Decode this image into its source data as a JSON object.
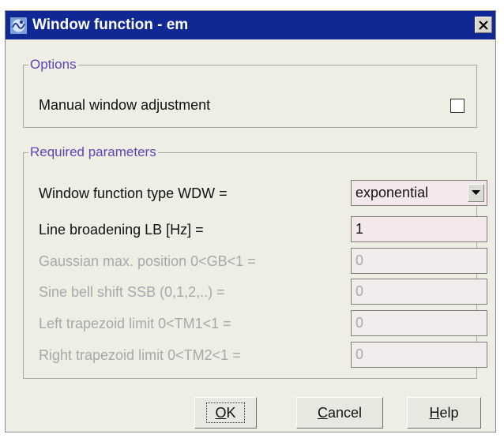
{
  "window": {
    "title": "Window function - em",
    "app_icon": "topspin-logo-icon",
    "close_icon": "close-icon"
  },
  "options": {
    "legend": "Options",
    "manual_adjustment": {
      "label": "Manual window adjustment",
      "checked": false
    }
  },
  "parameters": {
    "legend": "Required parameters",
    "rows": [
      {
        "label": "Window function type WDW =",
        "value": "exponential",
        "control": "select",
        "enabled": true
      },
      {
        "label": "Line broadening LB [Hz] =",
        "value": "1",
        "control": "text",
        "enabled": true
      },
      {
        "label": "Gaussian max. position 0<GB<1 =",
        "value": "0",
        "control": "text",
        "enabled": false
      },
      {
        "label": "Sine bell shift SSB (0,1,2,..) =",
        "value": "0",
        "control": "text",
        "enabled": false
      },
      {
        "label": "Left trapezoid limit 0<TM1<1 =",
        "value": "0",
        "control": "text",
        "enabled": false
      },
      {
        "label": "Right trapezoid limit 0<TM2<1 =",
        "value": "0",
        "control": "text",
        "enabled": false
      }
    ]
  },
  "buttons": {
    "ok": {
      "label": "OK",
      "mnemonic": "O",
      "rest": "K"
    },
    "cancel": {
      "label": "Cancel",
      "mnemonic": "C",
      "rest": "ancel"
    },
    "help": {
      "label": "Help",
      "mnemonic": "H",
      "rest": "elp"
    }
  },
  "colors": {
    "titlebar": "#0f2893",
    "dialog_background": "#eeeee5",
    "legend_text": "#5d43b5",
    "field_background": "#f5e8ea",
    "disabled_text": "#a8a8a8"
  }
}
